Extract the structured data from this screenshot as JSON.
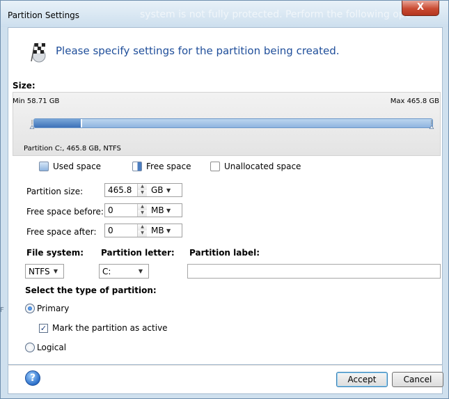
{
  "window": {
    "title": "Partition Settings",
    "background_text": "system is not fully protected. Perform the following ope",
    "close_label": "X"
  },
  "header": {
    "icon": "checkered-flag-icon",
    "text": "Please specify settings for the partition being created."
  },
  "size": {
    "label": "Size:",
    "min_label": "Min 58.71 GB",
    "max_label": "Max 465.8 GB",
    "partition_info": "Partition C:, 465.8 GB, NTFS",
    "used_fraction": 0.12
  },
  "legend": {
    "used": "Used space",
    "free": "Free space",
    "unallocated": "Unallocated space"
  },
  "fields": {
    "partition_size": {
      "label": "Partition size:",
      "value": "465.8",
      "unit": "GB"
    },
    "free_before": {
      "label": "Free space before:",
      "value": "0",
      "unit": "MB"
    },
    "free_after": {
      "label": "Free space after:",
      "value": "0",
      "unit": "MB"
    }
  },
  "columns": {
    "file_system": {
      "label": "File system:",
      "value": "NTFS"
    },
    "partition_letter": {
      "label": "Partition letter:",
      "value": "C:"
    },
    "partition_label": {
      "label": "Partition label:",
      "value": ""
    }
  },
  "type": {
    "heading": "Select the type of partition:",
    "primary": "Primary",
    "mark_active": "Mark the partition as active",
    "logical": "Logical",
    "selected": "primary",
    "mark_active_checked": true
  },
  "buttons": {
    "accept": "Accept",
    "cancel": "Cancel",
    "help_icon": "help-icon"
  },
  "side_scrap": "F"
}
